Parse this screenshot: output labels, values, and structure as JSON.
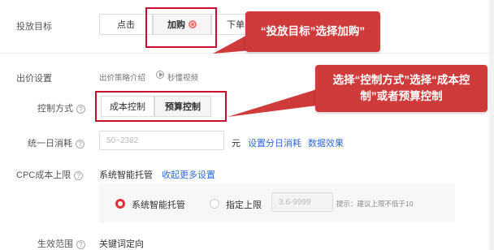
{
  "targeting": {
    "label": "投放目标",
    "options": [
      {
        "label": "点击",
        "active": false
      },
      {
        "label": "加购",
        "active": true,
        "icon": "target-icon"
      },
      {
        "label": "下单",
        "active": false
      }
    ]
  },
  "callout_goal": {
    "text": "“投放目标”选择加购”"
  },
  "bid": {
    "label": "出价设置",
    "strategy_intro": "出价策略介绍",
    "video_link": "秒懂视频"
  },
  "control": {
    "label": "控制方式",
    "options": [
      {
        "label": "成本控制",
        "active": false
      },
      {
        "label": "预算控制",
        "active": true
      }
    ]
  },
  "callout_control": {
    "text": "选择“控制方式”选择“成本控制”或者预算控制"
  },
  "daily_budget": {
    "label": "统一日消耗",
    "placeholder": "50~2382",
    "unit": "元",
    "link1": "设置分日消耗",
    "link2": "数据效果"
  },
  "cpc_limit": {
    "label": "CPC成本上限",
    "value": "系统智能托管",
    "link": "收起更多设置",
    "option_auto": "系统智能托管",
    "option_manual": "指定上限",
    "manual_placeholder": "3.6-9999",
    "hint": "提示：建议上限不低于10"
  },
  "effective_scope": {
    "label": "生效范围",
    "value": "关键词定向"
  },
  "colors": {
    "accent_red": "#cf3b3b",
    "box_red": "#c8102e",
    "link_blue": "#2f6bd8"
  }
}
